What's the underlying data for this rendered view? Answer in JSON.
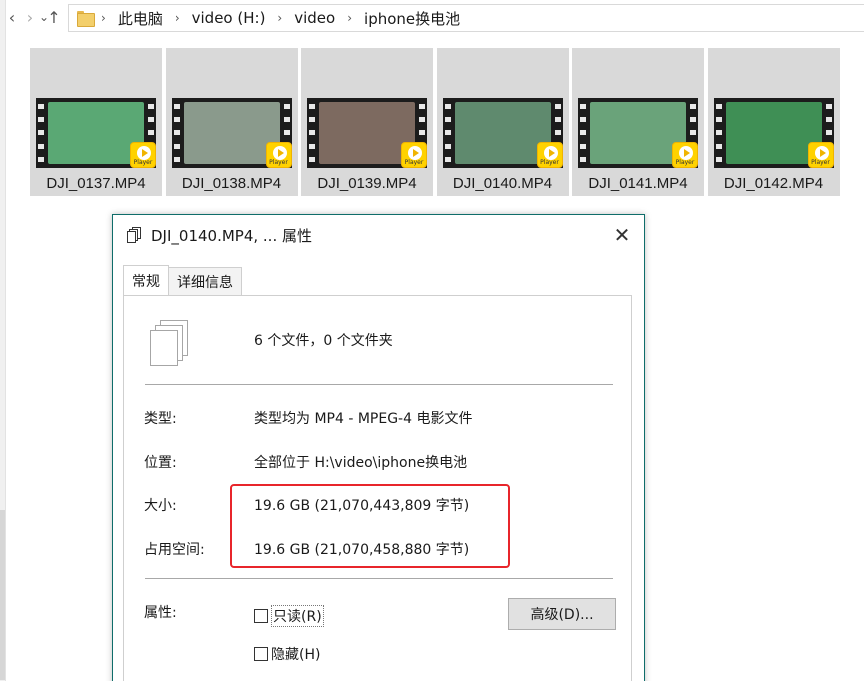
{
  "explorer": {
    "nav": {
      "back": "‹",
      "forward": "›",
      "dropdown": "⌄",
      "up": "↑"
    },
    "breadcrumb": [
      "此电脑",
      "video (H:)",
      "video",
      "iphone换电池"
    ],
    "separator": "›"
  },
  "files": [
    {
      "name": "DJI_0137.MP4",
      "badge": "Player",
      "frame_color": "#5aa874"
    },
    {
      "name": "DJI_0138.MP4",
      "badge": "Player",
      "frame_color": "#8a9a8c"
    },
    {
      "name": "DJI_0139.MP4",
      "badge": "Player",
      "frame_color": "#7d6a60"
    },
    {
      "name": "DJI_0140.MP4",
      "badge": "Player",
      "frame_color": "#5f8a6e"
    },
    {
      "name": "DJI_0141.MP4",
      "badge": "Player",
      "frame_color": "#6aa37a"
    },
    {
      "name": "DJI_0142.MP4",
      "badge": "Player",
      "frame_color": "#3f8f55"
    }
  ],
  "dialog": {
    "title": "DJI_0140.MP4, ... 属性",
    "close": "✕",
    "tabs": [
      "常规",
      "详细信息"
    ],
    "count_text": "6 个文件，0 个文件夹",
    "rows": [
      {
        "label": "类型:",
        "value": "类型均为 MP4 - MPEG-4 电影文件"
      },
      {
        "label": "位置:",
        "value": "全部位于 H:\\video\\iphone换电池"
      },
      {
        "label": "大小:",
        "value": "19.6 GB (21,070,443,809 字节)"
      },
      {
        "label": "占用空间:",
        "value": "19.6 GB (21,070,458,880 字节)"
      }
    ],
    "attributes_label": "属性:",
    "checkboxes": [
      {
        "label": "只读(R)",
        "checked": false
      },
      {
        "label": "隐藏(H)",
        "checked": false
      }
    ],
    "advanced_button": "高级(D)..."
  },
  "colors": {
    "dialog_border": "#0f6d6a",
    "highlight": "#e8252b",
    "thumb_bg": "#d9d9d9",
    "player_badge": "#ffd200"
  }
}
